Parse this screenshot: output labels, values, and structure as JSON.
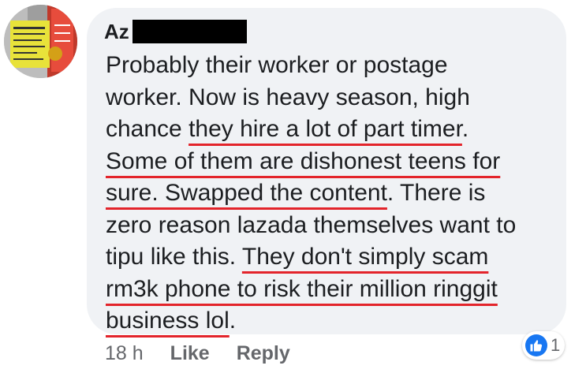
{
  "comment": {
    "author": "Az",
    "lines": [
      [
        "Probably their worker or postage"
      ],
      [
        "worker. Now is heavy season, high"
      ],
      [
        "chance ",
        "they hire a lot of part timer",
        "."
      ],
      [
        "Some of them are dishonest teens for"
      ],
      [
        "sure. Swapped the content",
        ". There is"
      ],
      [
        "zero reason lazada themselves want to"
      ],
      [
        "tipu like this. ",
        "They don't simply scam"
      ],
      [
        "rm3k phone to risk their million ringgit"
      ],
      [
        "business lol",
        "."
      ]
    ]
  },
  "actions": {
    "time": "18 h",
    "like_label": "Like",
    "reply_label": "Reply"
  },
  "reactions": {
    "icon": "thumbs-up-icon",
    "count": "1",
    "color": "#1877f2"
  },
  "colors": {
    "bubble": "#f0f2f5",
    "underline": "#e3242b",
    "text": "#1c1e21",
    "meta": "#65676b"
  }
}
